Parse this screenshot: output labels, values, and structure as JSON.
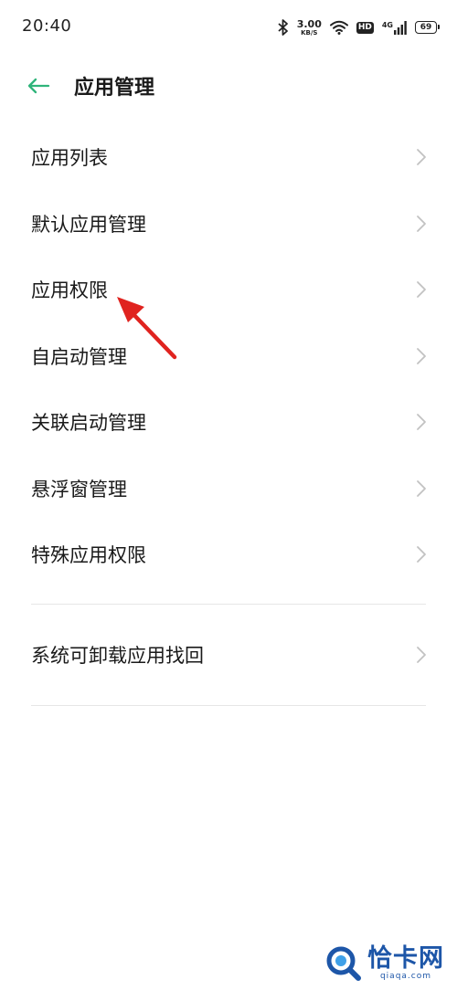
{
  "status_bar": {
    "time": "20:40",
    "net_speed_value": "3.00",
    "net_speed_unit": "KB/S",
    "hd_label": "HD",
    "network_type": "4G",
    "battery_level": "69"
  },
  "header": {
    "title": "应用管理",
    "back_icon": "arrow-left-icon",
    "accent_color": "#2fb47a"
  },
  "menu": {
    "items": [
      {
        "label": "应用列表"
      },
      {
        "label": "默认应用管理"
      },
      {
        "label": "应用权限"
      },
      {
        "label": "自启动管理"
      },
      {
        "label": "关联启动管理"
      },
      {
        "label": "悬浮窗管理"
      },
      {
        "label": "特殊应用权限"
      }
    ],
    "extra_items": [
      {
        "label": "系统可卸载应用找回"
      }
    ],
    "chevron_icon": "chevron-right-icon"
  },
  "annotation": {
    "arrow_color": "#e0231f"
  },
  "watermark": {
    "text": "恰卡网",
    "subtext": "qiaqa.com",
    "color": "#1d56a8"
  }
}
